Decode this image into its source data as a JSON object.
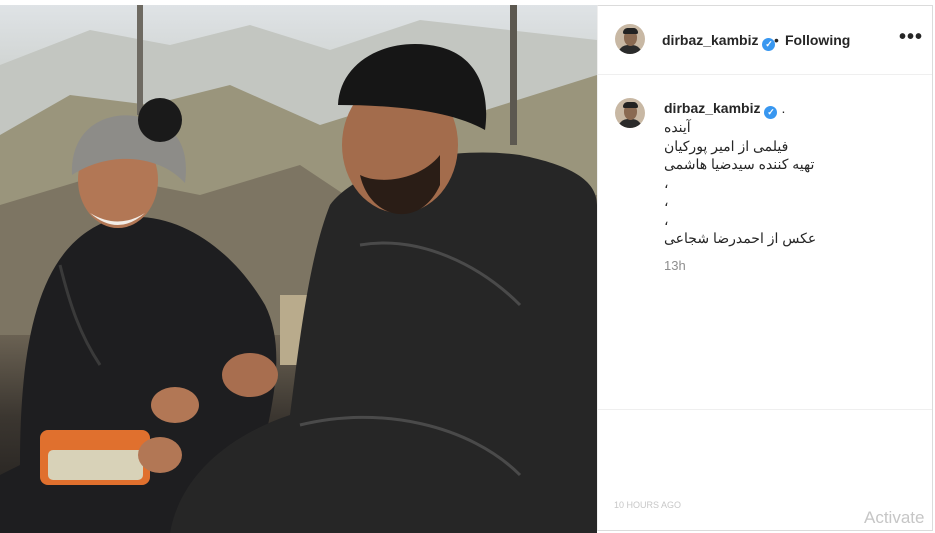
{
  "post": {
    "image_alt": "Photo of a man in a black leather jacket and bandana and a laughing woman in a knit beanie outdoors",
    "author": {
      "username": "dirbaz_kambiz",
      "verified_icon": "verified-badge-icon"
    },
    "header": {
      "separator": "•",
      "follow_status": "Following",
      "more_label": "•••"
    },
    "caption": {
      "username": "dirbaz_kambiz",
      "first_line_suffix": ".",
      "lines": [
        "آینده",
        "فیلمی از امیر پورکیان",
        "تهیه کننده سیدضیا هاشمی",
        "،",
        "،",
        "،",
        "عکس از احمدرضا شجاعی"
      ]
    },
    "timestamp": "13h",
    "faded_text": "10 HOURS AGO"
  },
  "overlay": {
    "windows_watermark": "Activate"
  },
  "colors": {
    "verified": "#3897f0",
    "text": "#262626",
    "secondary": "#8e8e8e",
    "border": "#dbdbdb"
  }
}
